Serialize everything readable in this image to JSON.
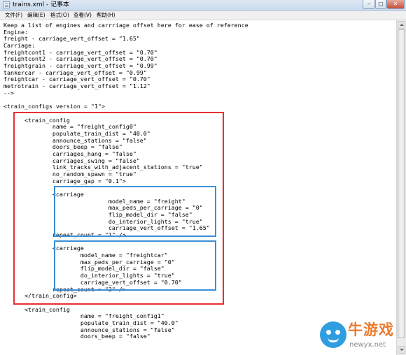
{
  "window": {
    "title": "trains.xml - 记事本",
    "controls": {
      "minimize": "–",
      "maximize": "□",
      "close": "✕"
    }
  },
  "menu": {
    "items": [
      "文件(F)",
      "编辑(E)",
      "格式(O)",
      "查看(V)",
      "帮助(H)"
    ]
  },
  "editor": {
    "lines": [
      "Keep a list of engines and carrriage offset here for ease of reference",
      "Engine:",
      "freight - carriage_vert_offset = \"1.65\"",
      "Carriage:",
      "freightcont1 - carriage_vert_offset = \"0.70\"",
      "freightcont2 - carriage_vert_offset = \"0.70\"",
      "freightgrain - carriage_vert_offset = \"0.99\"",
      "tankercar - carriage_vert_offset = \"0.99\"",
      "freightcar - carriage_vert_offset = \"0.70\"",
      "metrotrain - carriage_vert_offset = \"1.12\"",
      "-->",
      "",
      "<train_configs version = \"1\">",
      "",
      "      <train_config",
      "              name = \"freight_config0\"",
      "              populate_train_dist = \"40.0\"",
      "              announce_stations = \"false\"",
      "              doors_beep = \"false\"",
      "              carriages_hang = \"false\"",
      "              carriages_swing = \"false\"",
      "              link_tracks_with_adjacent_stations = \"true\"",
      "              no_random_spawn = \"true\"",
      "              carriage_gap = \"0.1\">",
      "",
      "              <carriage",
      "                              model_name = \"freight\"",
      "                              max_peds_per_carriage = \"0\"",
      "                              flip_model_dir = \"false\"",
      "                              do_interior_lights = \"true\"",
      "                              carriage_vert_offset = \"1.65\"",
      "              repeat_count = \"1\" />",
      "",
      "              <carriage",
      "                      model_name = \"freightcar\"",
      "                      max_peds_per_carriage = \"0\"",
      "                      flip_model_dir = \"false\"",
      "                      do_interior_lights = \"true\"",
      "                      carriage_vert_offset = \"0.70\"",
      "              repeat_count = \"2\" />",
      "      </train_config>",
      "",
      "      <train_config",
      "                      name = \"freight_config1\"",
      "                      populate_train_dist = \"40.0\"",
      "                      announce_stations = \"false\"",
      "                      doors_beep = \"false\""
    ]
  },
  "watermark": {
    "text": "牛游戏",
    "url": "newyx.net",
    "icon": "cartoon-face-icon"
  },
  "colors": {
    "highlight_outer": "#e8302f",
    "highlight_inner": "#3a8fd8",
    "watermark_text": "#ec7b2f",
    "watermark_icon": "#2f9ee0"
  }
}
